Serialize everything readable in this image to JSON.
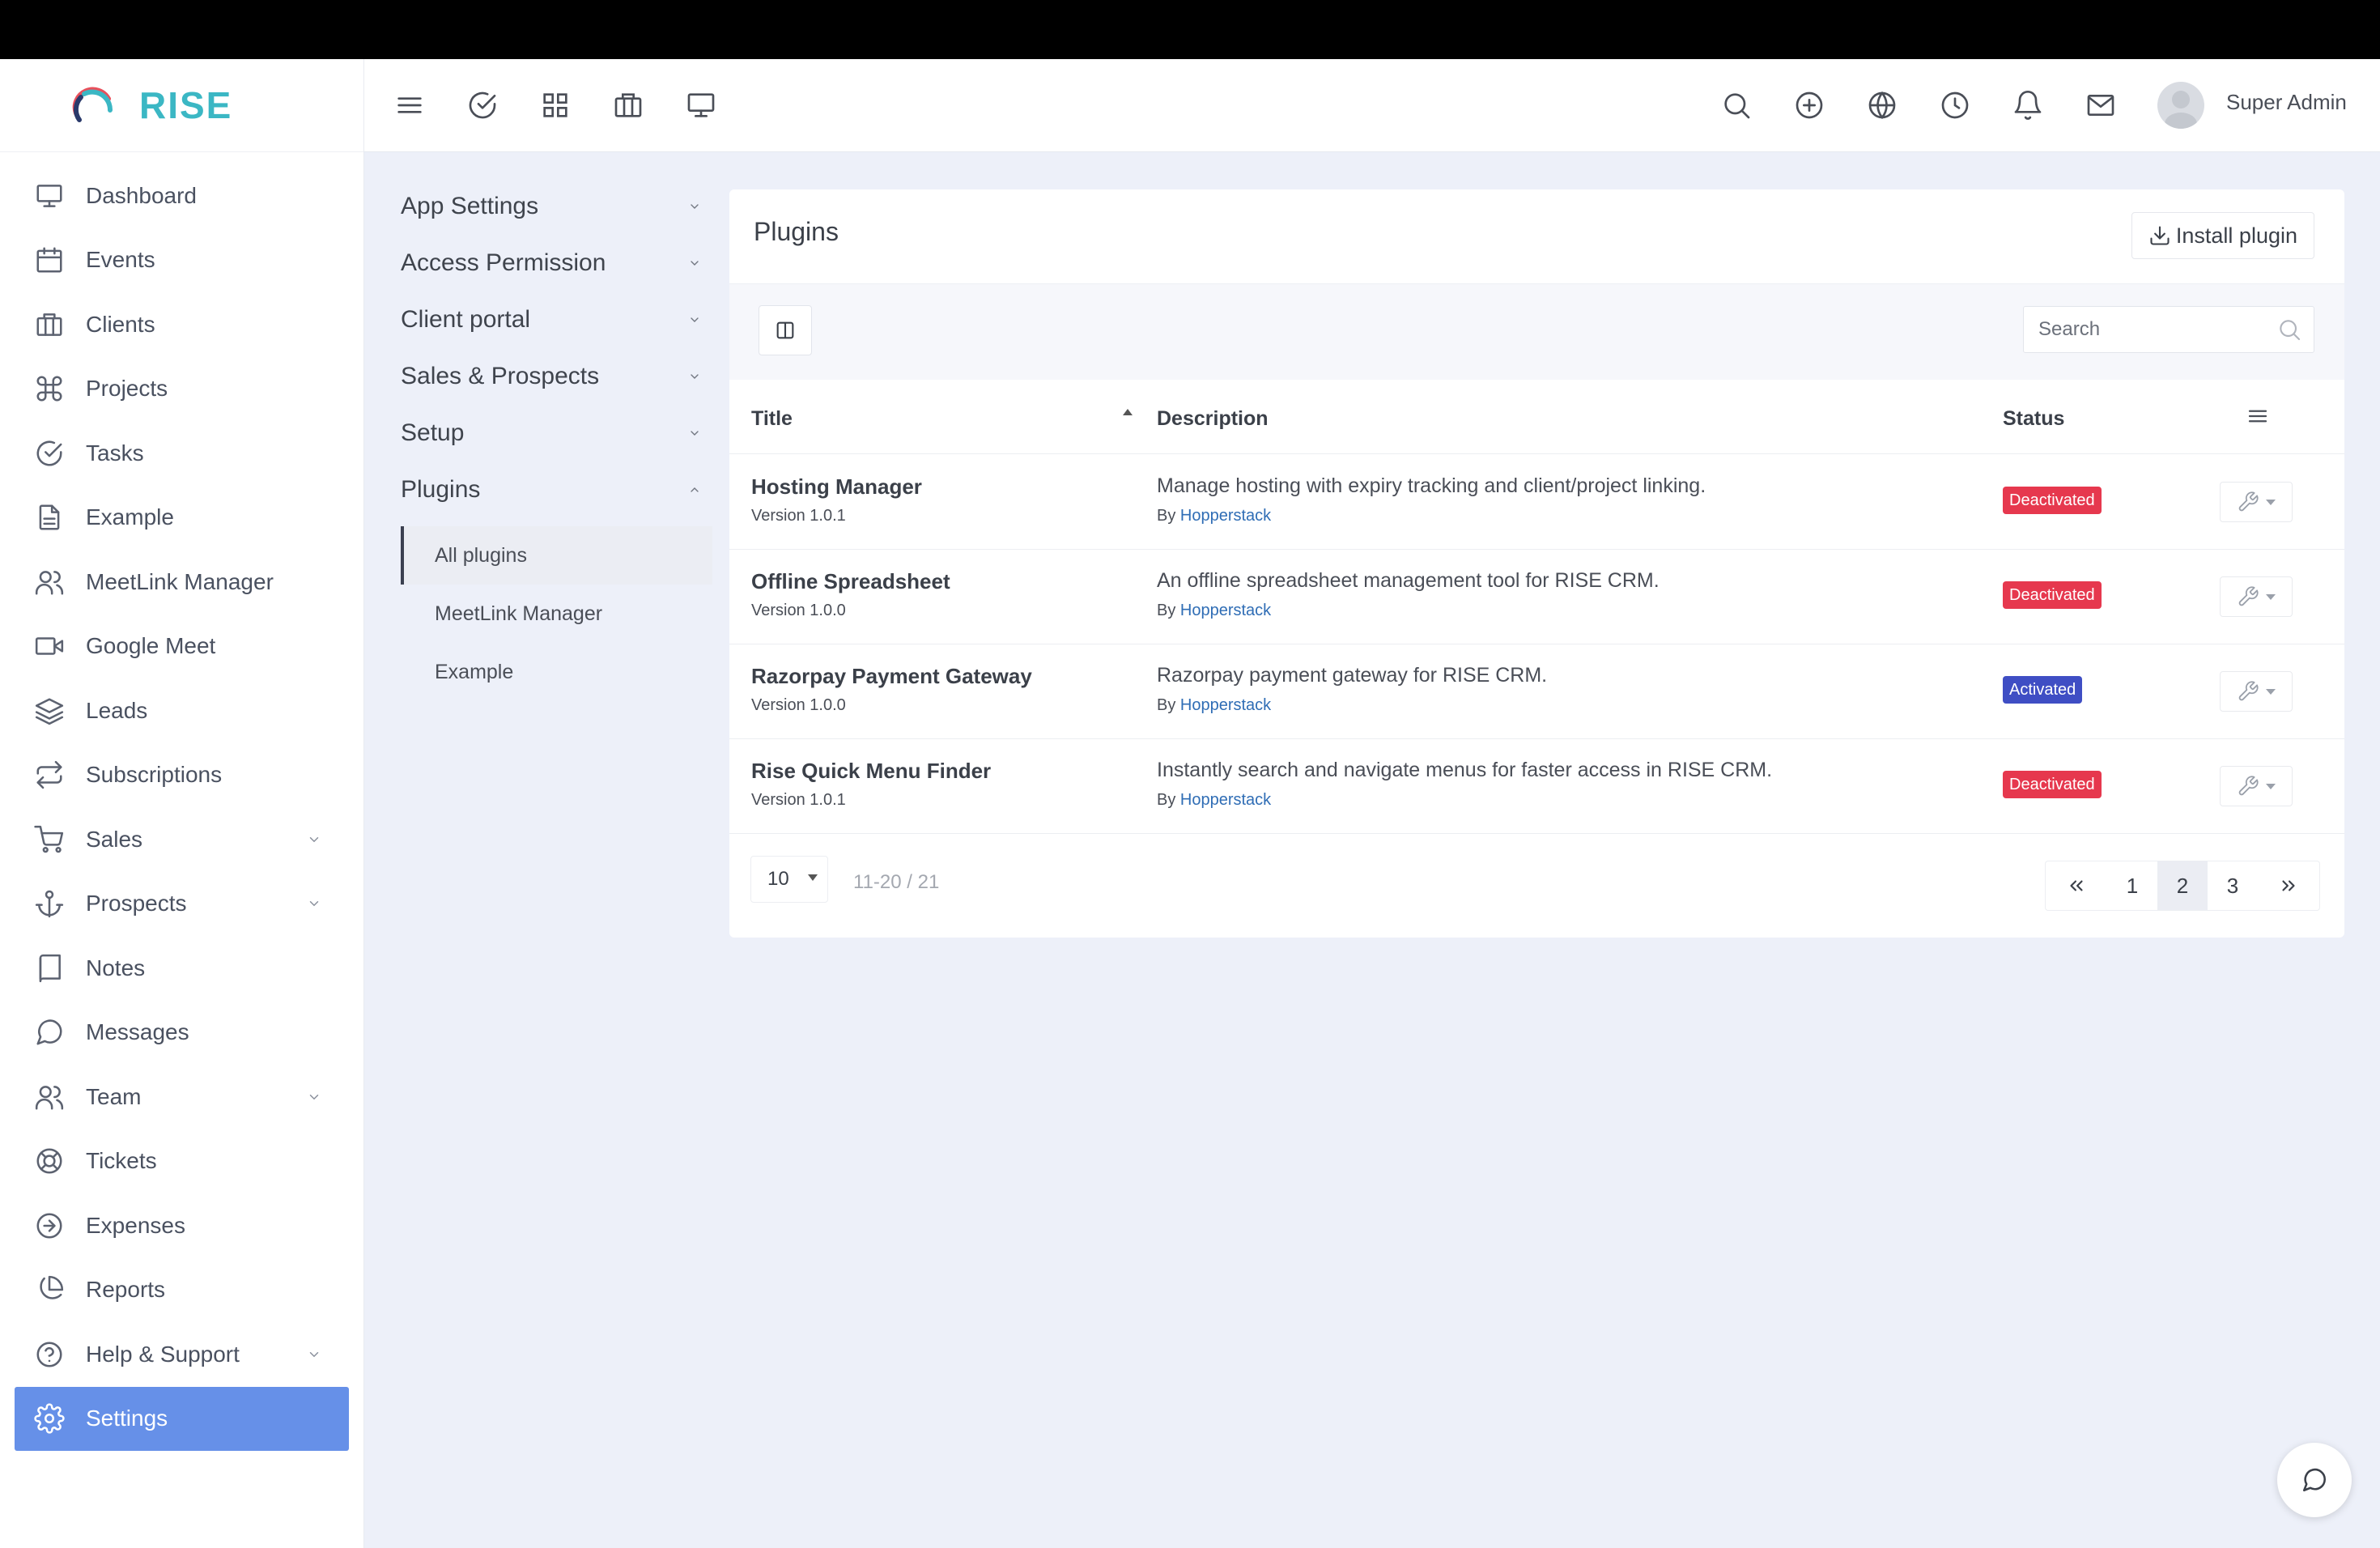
{
  "app": {
    "brand": "RISE",
    "brand_color": "#3bb7c4",
    "accent": "#6690e8"
  },
  "header": {
    "left_icons": [
      "menu-icon",
      "check-circle-icon",
      "grid-icon",
      "briefcase-icon",
      "monitor-icon"
    ],
    "right_icons": [
      "search-icon",
      "plus-circle-icon",
      "globe-icon",
      "clock-icon",
      "bell-icon",
      "mail-icon"
    ],
    "user_name": "Super Admin"
  },
  "sidebar": {
    "items": [
      {
        "label": "Dashboard",
        "icon": "monitor-icon"
      },
      {
        "label": "Events",
        "icon": "calendar-icon"
      },
      {
        "label": "Clients",
        "icon": "briefcase-icon"
      },
      {
        "label": "Projects",
        "icon": "command-icon"
      },
      {
        "label": "Tasks",
        "icon": "check-circle-icon"
      },
      {
        "label": "Example",
        "icon": "file-icon"
      },
      {
        "label": "MeetLink Manager",
        "icon": "users-icon"
      },
      {
        "label": "Google Meet",
        "icon": "video-icon"
      },
      {
        "label": "Leads",
        "icon": "layers-icon"
      },
      {
        "label": "Subscriptions",
        "icon": "repeat-icon"
      },
      {
        "label": "Sales",
        "icon": "cart-icon",
        "expandable": true
      },
      {
        "label": "Prospects",
        "icon": "anchor-icon",
        "expandable": true
      },
      {
        "label": "Notes",
        "icon": "book-icon"
      },
      {
        "label": "Messages",
        "icon": "message-icon"
      },
      {
        "label": "Team",
        "icon": "users-icon",
        "expandable": true
      },
      {
        "label": "Tickets",
        "icon": "life-buoy-icon"
      },
      {
        "label": "Expenses",
        "icon": "arrow-circle-icon"
      },
      {
        "label": "Reports",
        "icon": "pie-chart-icon"
      },
      {
        "label": "Help & Support",
        "icon": "help-circle-icon",
        "expandable": true
      },
      {
        "label": "Settings",
        "icon": "gear-icon",
        "active": true
      }
    ]
  },
  "settings_menu": {
    "sections": [
      {
        "label": "App Settings"
      },
      {
        "label": "Access Permission"
      },
      {
        "label": "Client portal"
      },
      {
        "label": "Sales & Prospects"
      },
      {
        "label": "Setup"
      },
      {
        "label": "Plugins",
        "expanded": true
      }
    ],
    "plugin_subitems": [
      {
        "label": "All plugins",
        "active": true
      },
      {
        "label": "MeetLink Manager"
      },
      {
        "label": "Example"
      }
    ]
  },
  "plugins_card": {
    "title": "Plugins",
    "install_label": "Install plugin",
    "search_placeholder": "Search",
    "columns": {
      "title": "Title",
      "description": "Description",
      "status": "Status"
    },
    "rows": [
      {
        "title": "Hosting Manager",
        "version": "Version 1.0.1",
        "description": "Manage hosting with expiry tracking and client/project linking.",
        "by": "By",
        "author": "Hopperstack",
        "status": "Deactivated"
      },
      {
        "title": "Offline Spreadsheet",
        "version": "Version 1.0.0",
        "description": "An offline spreadsheet management tool for RISE CRM.",
        "by": "By",
        "author": "Hopperstack",
        "status": "Deactivated"
      },
      {
        "title": "Razorpay Payment Gateway",
        "version": "Version 1.0.0",
        "description": "Razorpay payment gateway for RISE CRM.",
        "by": "By",
        "author": "Hopperstack",
        "status": "Activated"
      },
      {
        "title": "Rise Quick Menu Finder",
        "version": "Version 1.0.1",
        "description": "Instantly search and navigate menus for faster access in RISE CRM.",
        "by": "By",
        "author": "Hopperstack",
        "status": "Deactivated"
      }
    ],
    "page_size": "10",
    "page_info": "11-20 / 21",
    "pages": [
      "1",
      "2",
      "3"
    ],
    "current_page": "2",
    "status_colors": {
      "Deactivated": "#e6384e",
      "Activated": "#3f4ec4"
    }
  }
}
